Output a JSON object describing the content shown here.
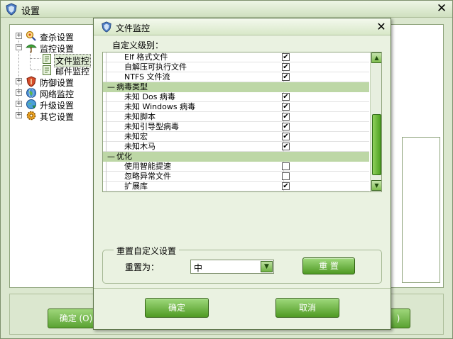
{
  "outer": {
    "title": "设置",
    "close_glyph": "✕",
    "tree": {
      "items": [
        {
          "label": "查杀设置",
          "icon": "magnifier-virus-icon"
        },
        {
          "label": "监控设置",
          "icon": "umbrella-icon"
        },
        {
          "label": "文件监控",
          "icon": "file-icon"
        },
        {
          "label": "邮件监控",
          "icon": "file-icon"
        },
        {
          "label": "防御设置",
          "icon": "shield-icon"
        },
        {
          "label": "网络监控",
          "icon": "globe-icon"
        },
        {
          "label": "升级设置",
          "icon": "globe-update-icon"
        },
        {
          "label": "其它设置",
          "icon": "gear-icon"
        }
      ]
    },
    "ok_label": "确定 (O)",
    "right_btn_label": ")"
  },
  "dialog": {
    "title": "文件监控",
    "close_glyph": "✕",
    "custom_level_label": "自定义级别：",
    "list": [
      {
        "type": "item",
        "name": "Elf 格式文件",
        "checked": true
      },
      {
        "type": "item",
        "name": "自解压可执行文件",
        "checked": true
      },
      {
        "type": "item",
        "name": "NTFS 文件流",
        "checked": true
      },
      {
        "type": "group",
        "name": "病毒类型",
        "toggle": "—"
      },
      {
        "type": "item",
        "name": "未知 Dos 病毒",
        "checked": true
      },
      {
        "type": "item",
        "name": "未知 Windows 病毒",
        "checked": true
      },
      {
        "type": "item",
        "name": "未知脚本",
        "checked": true
      },
      {
        "type": "item",
        "name": "未知引导型病毒",
        "checked": true
      },
      {
        "type": "item",
        "name": "未知宏",
        "checked": true
      },
      {
        "type": "item",
        "name": "未知木马",
        "checked": true
      },
      {
        "type": "group",
        "name": "优化",
        "toggle": "—"
      },
      {
        "type": "item",
        "name": "使用智能提速",
        "checked": false
      },
      {
        "type": "item",
        "name": "忽略异常文件",
        "checked": false
      },
      {
        "type": "item",
        "name": "扩展库",
        "checked": true
      }
    ],
    "scroll_position": 0.72,
    "reset": {
      "legend": "重置自定义设置",
      "to_label": "重置为：",
      "selected": "中",
      "button_label": "重 置"
    },
    "ok_label": "确定",
    "cancel_label": "取消"
  },
  "colors": {
    "window_bg": "#dbe7cf",
    "group_row_bg": "#bdd7a6",
    "button_green": "#5aa232"
  }
}
